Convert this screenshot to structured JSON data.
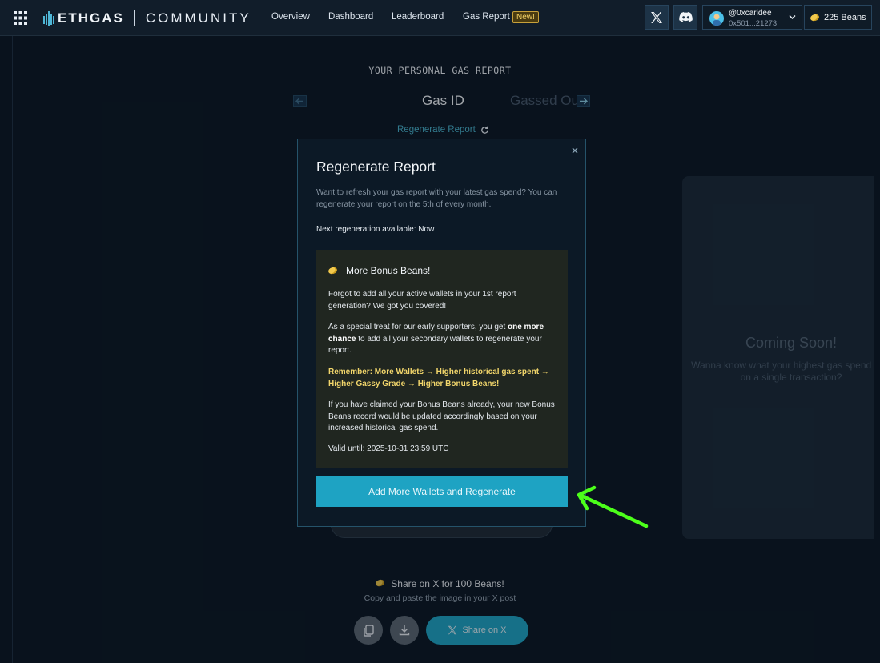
{
  "nav": {
    "brand": "ETHGAS",
    "brand_sub": "COMMUNITY",
    "links": [
      "Overview",
      "Dashboard",
      "Leaderboard",
      "Gas Report"
    ],
    "new_badge": "New!",
    "wallet_name": "@0xcaridee",
    "wallet_address": "0x501...21273",
    "beans": "225 Beans"
  },
  "page": {
    "heading": "YOUR PERSONAL GAS REPORT",
    "tab_active": "Gas ID",
    "tab_inactive": "Gassed Out",
    "regenerate_link": "Regenerate Report"
  },
  "coming_soon": {
    "title": "Coming Soon!",
    "subtitle": "Wanna know what your highest gas spend was on a single transaction?"
  },
  "modal": {
    "title": "Regenerate Report",
    "description": "Want to refresh your gas report with your latest gas spend? You can regenerate your report on the 5th of every month.",
    "next_regen": "Next regeneration available: Now",
    "bonus_title": "More Bonus Beans!",
    "bonus_p1": "Forgot to add all your active wallets in your 1st report generation? We got you covered!",
    "bonus_p2_pre": "As a special treat for our early supporters, you get ",
    "bonus_p2_bold": "one more chance",
    "bonus_p2_post": " to add all your secondary wallets to regenerate your report.",
    "bonus_highlight": "Remember: More Wallets → Higher historical gas spent → Higher Gassy Grade → Higher Bonus Beans!",
    "bonus_p4": "If you have claimed your Bonus Beans already, your new Bonus Beans record would be updated accordingly based on your increased historical gas spend.",
    "valid_until": "Valid until: 2025-10-31 23:59 UTC",
    "cta": "Add More Wallets and Regenerate"
  },
  "share": {
    "title": "Share on X for 100 Beans!",
    "subtitle": "Copy and paste the image in your X post",
    "share_button": "Share on X"
  },
  "icons": [
    "apps-grid-icon",
    "ethgas-logo-icon",
    "x-logo-icon",
    "discord-icon",
    "chevron-down-icon",
    "bean-icon",
    "arrow-left-icon",
    "arrow-right-icon",
    "refresh-icon",
    "close-icon",
    "copy-icon",
    "download-icon"
  ],
  "colors": {
    "accent": "#1ea3c3",
    "highlight": "#f2d66b",
    "annotation": "#4cff1a"
  }
}
